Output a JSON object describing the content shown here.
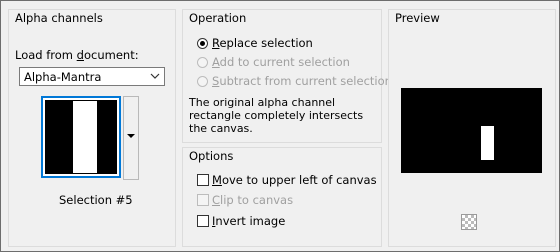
{
  "alpha_channels": {
    "title": "Alpha channels",
    "load_label_pre": "Load from ",
    "load_label_u": "d",
    "load_label_post": "ocument:",
    "document_value": "Alpha-Mantra",
    "selection_label": "Selection #5"
  },
  "operation": {
    "title": "Operation",
    "options": [
      {
        "u": "R",
        "rest": "eplace selection",
        "selected": true,
        "enabled": true
      },
      {
        "u": "A",
        "rest": "dd to current selection",
        "selected": false,
        "enabled": false
      },
      {
        "u": "S",
        "rest": "ubtract from current selection",
        "selected": false,
        "enabled": false
      }
    ],
    "description": "The original alpha channel rectangle completely intersects the canvas."
  },
  "options": {
    "title": "Options",
    "items": [
      {
        "u": "M",
        "rest": "ove to upper left of canvas",
        "checked": false,
        "enabled": true
      },
      {
        "u": "C",
        "rest": "lip to canvas",
        "checked": false,
        "enabled": false
      },
      {
        "u": "I",
        "rest": "nvert image",
        "checked": false,
        "enabled": true
      }
    ]
  },
  "preview": {
    "title": "Preview"
  },
  "icons": {
    "dropdown": "chevron-down-icon",
    "thumb_menu": "triangle-down-icon",
    "checker": "checkerboard-icon"
  },
  "colors": {
    "accent": "#0078d7",
    "background": "#f0f0f0"
  }
}
